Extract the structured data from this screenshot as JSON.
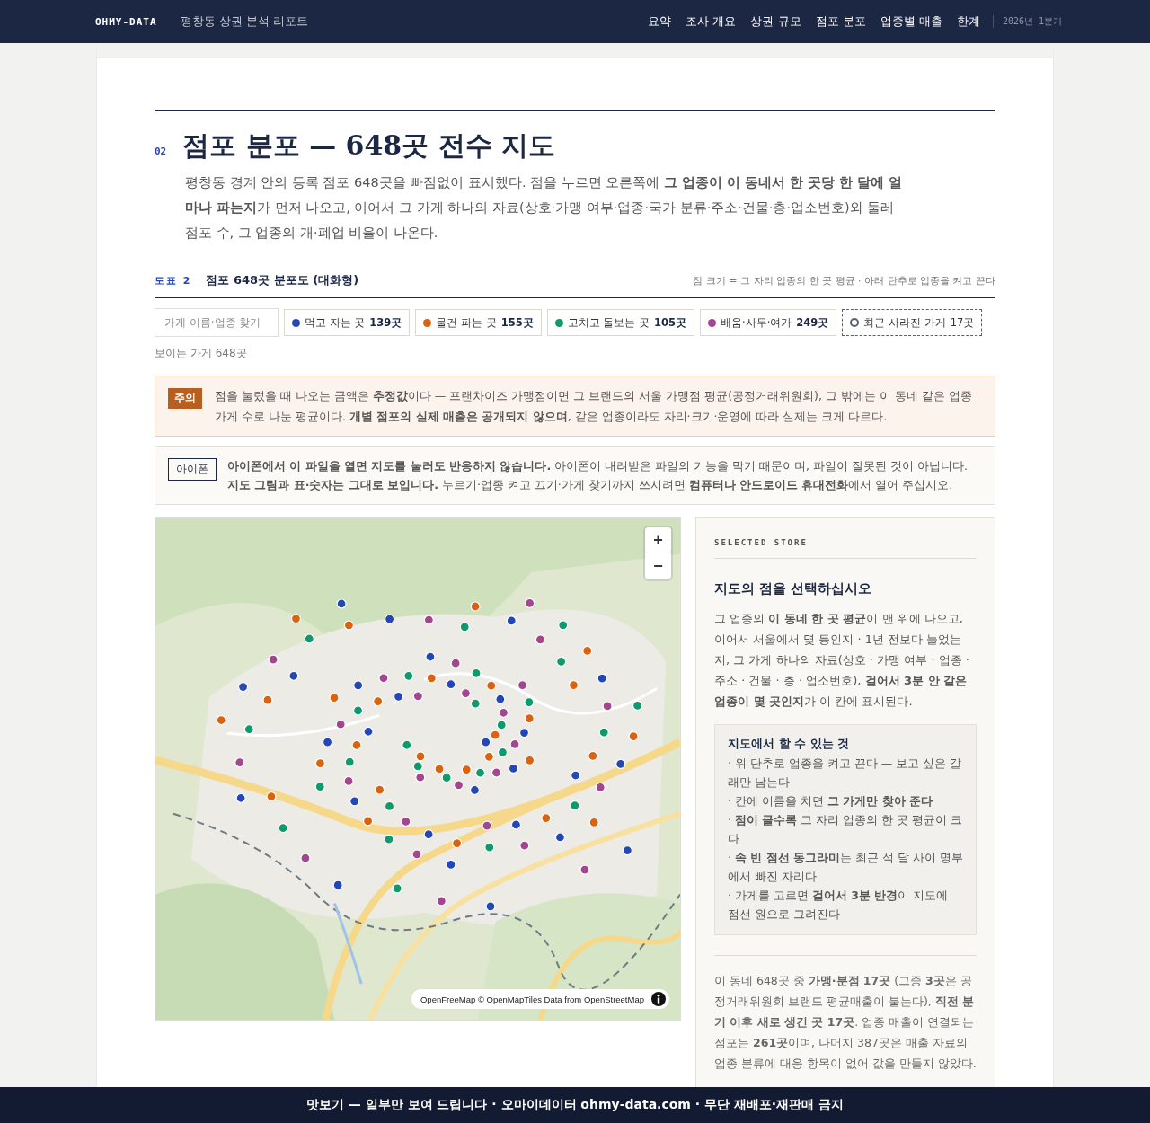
{
  "header": {
    "brand": "OHMY-DATA",
    "report_title": "평창동 상권 분석 리포트",
    "nav": [
      "요약",
      "조사 개요",
      "상권 규모",
      "점포 분포",
      "업종별 매출",
      "한계"
    ],
    "period": "2026년 1분기"
  },
  "section": {
    "number": "02",
    "title": "점포 분포 — 648곳 전수 지도",
    "intro": "평창동 경계 안의 등록 점포 648곳을 빠짐없이 표시했다. 점을 누르면 오른쪽에 **그 업종이 이 동네서 한 곳당 한 달에 얼마나 파는지**가 먼저 나오고, 이어서 그 가게 하나의 자료(상호·가맹 여부·업종·국가 분류·주소·건물·층·업소번호)와 둘레 점포 수, 그 업종의 개·폐업 비율이 나온다."
  },
  "figure": {
    "label": "도표 2",
    "title": "점포 648곳 분포도 (대화형)",
    "note": "점 크기 = 그 자리 업종의 한 곳 평균 · 아래 단추로 업종을 켜고 끈다",
    "search": {
      "placeholder": "가게 이름·업종 찾기"
    },
    "filters": [
      {
        "kind": "category",
        "color": "#2447b8",
        "label": "먹고 자는 곳",
        "count": "139곳"
      },
      {
        "kind": "category",
        "color": "#d9630f",
        "label": "물건 파는 곳",
        "count": "155곳"
      },
      {
        "kind": "category",
        "color": "#0f9a6e",
        "label": "고치고 돌보는 곳",
        "count": "105곳"
      },
      {
        "kind": "category",
        "color": "#a4468f",
        "label": "배움·사무·여가",
        "count": "249곳"
      },
      {
        "kind": "closed",
        "color": "#5a6070",
        "label": "최근 사라진 가게",
        "count": "17곳"
      }
    ],
    "visible_count": "보이는 가게 648곳"
  },
  "caution": {
    "tag": "주의",
    "text": "점을 눌렀을 때 나오는 금액은 **추정값**이다 — 프랜차이즈 가맹점이면 그 브랜드의 서울 가맹점 평균(공정거래위원회), 그 밖에는 이 동네 같은 업종 가게 수로 나눈 평균이다. **개별 점포의 실제 매출은 공개되지 않으며**, 같은 업종이라도 자리·크기·운영에 따라 실제는 크게 다르다."
  },
  "iphone_notice": {
    "tag": "아이폰",
    "text": "**아이폰에서 이 파일을 열면 지도를 눌러도 반응하지 않습니다.** 아이폰이 내려받은 파일의 기능을 막기 때문이며, 파일이 잘못된 것이 아닙니다. **지도 그림과 표·숫자는 그대로 보입니다.** 누르기·업종 켜고 끄기·가게 찾기까지 쓰시려면 **컴퓨터나 안드로이드 휴대전화**에서 열어 주십시오."
  },
  "map": {
    "zoom_in": "+",
    "zoom_out": "−",
    "attribution": "OpenFreeMap © OpenMapTiles Data from OpenStreetMap"
  },
  "panel": {
    "eyebrow": "SELECTED STORE",
    "title": "지도의 점을 선택하십시오",
    "description": "그 업종의 **이 동네 한 곳 평균**이 맨 위에 나오고, 이어서 서울에서 몇 등인지 · 1년 전보다 늘었는지, 그 가게 하나의 자료(상호 · 가맹 여부 · 업종 · 주소 · 건물 · 층 · 업소번호), **걸어서 3분 안 같은 업종이 몇 곳인지**가 이 칸에 표시된다.",
    "tips": {
      "title": "지도에서 할 수 있는 것",
      "items": [
        "· 위 단추로 업종을 켜고 끈다 — 보고 싶은 갈래만 남는다",
        "· 칸에 이름을 치면 **그 가게만 찾아 준다**",
        "· **점이 클수록** 그 자리 업종의 한 곳 평균이 크다",
        "· **속 빈 점선 동그라미**는 최근 석 달 사이 명부에서 빠진 자리다",
        "· 가게를 고르면 **걸어서 3분 반경**이 지도에 점선 원으로 그려진다"
      ]
    },
    "summary": "이 동네 648곳 중 **가맹·분점 17곳** (그중 **3곳**은 공정거래위원회 브랜드 평균매출이 붙는다), **직전 분기 이후 새로 생긴 곳 17곳**. 업종 매출이 연결되는 점포는 **261곳**이며, 나머지 387곳은 매출 자료의 업종 분류에 대응 항목이 없어 값을 만들지 않았다."
  },
  "footer": "맛보기 — 일부만 보여 드립니다 · 오마이데이터 ohmy-data.com · 무단 재배포·재판매 금지"
}
